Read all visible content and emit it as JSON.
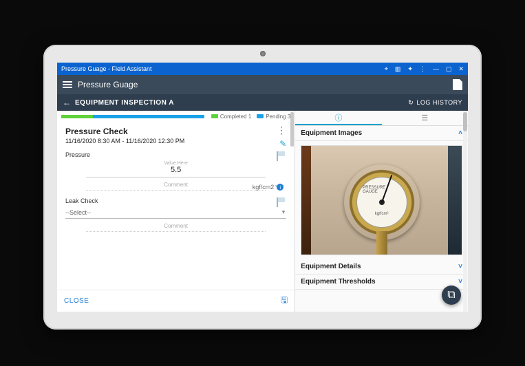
{
  "os_title": "Pressure Guage - Field Assistant",
  "app": {
    "title": "Pressure Guage"
  },
  "subheader": {
    "crumb": "EQUIPMENT INSPECTION A",
    "log_history": "LOG HISTORY"
  },
  "progress": {
    "completed_label": "Completed",
    "completed_count": "1",
    "pending_label": "Pending",
    "pending_count": "3"
  },
  "check": {
    "title": "Pressure Check",
    "range": "11/16/2020 8:30 AM - 11/16/2020 12:30 PM"
  },
  "fields": {
    "pressure": {
      "label": "Pressure",
      "value_header": "Value Here",
      "value": "5.5",
      "unit": "kgf/cm2",
      "comment_placeholder": "Comment"
    },
    "leak": {
      "label": "Leak Check",
      "select_placeholder": "--Select--",
      "comment_placeholder": "Comment"
    }
  },
  "footer": {
    "close": "CLOSE"
  },
  "right": {
    "images_header": "Equipment Images",
    "details_header": "Equipment Details",
    "thresholds_header": "Equipment Thresholds",
    "gauge_label": "PRESSURE GAUGE",
    "gauge_unit": "kgf/cm²"
  }
}
